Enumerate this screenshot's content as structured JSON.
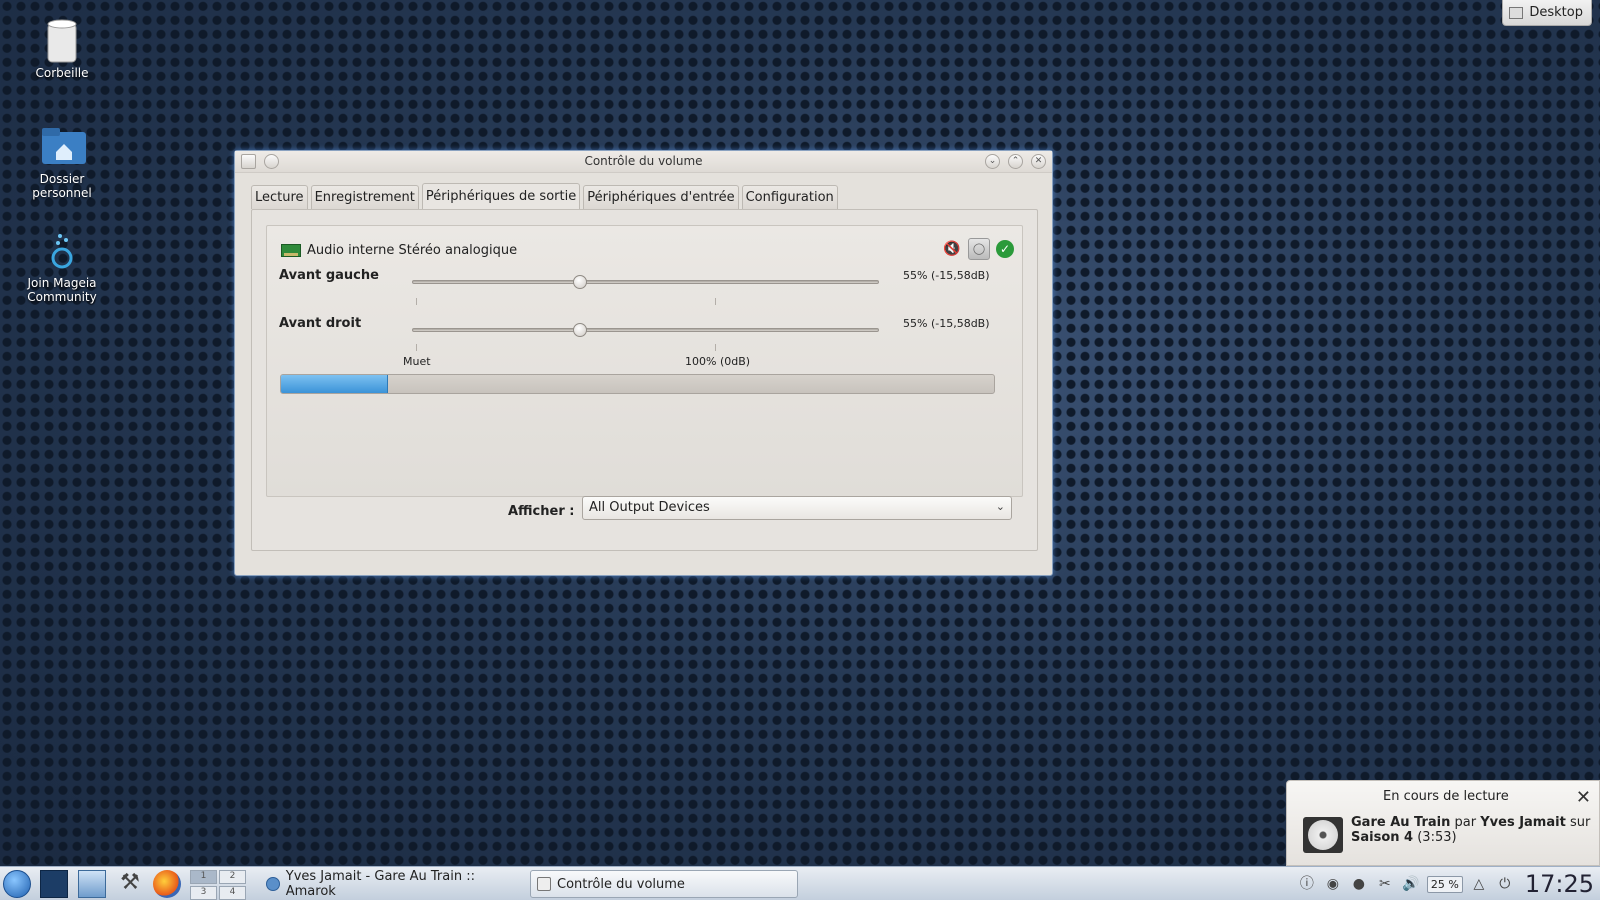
{
  "desktop": {
    "icons": [
      {
        "label": "Corbeille"
      },
      {
        "label": "Dossier\npersonnel"
      },
      {
        "label": "Join Mageia\nCommunity"
      }
    ],
    "desktop_button": "Desktop"
  },
  "window": {
    "title": "Contrôle du volume",
    "tabs": [
      {
        "label": "Lecture"
      },
      {
        "label": "Enregistrement"
      },
      {
        "label": "Périphériques de sortie",
        "active": true
      },
      {
        "label": "Périphériques d'entrée"
      },
      {
        "label": "Configuration"
      }
    ],
    "device": {
      "name": "Audio interne Stéréo analogique",
      "channels": [
        {
          "label": "Avant gauche",
          "level": 0.55,
          "value": "55% (-15,58dB)"
        },
        {
          "label": "Avant droit",
          "level": 0.55,
          "value": "55% (-15,58dB)"
        }
      ],
      "scale_mute": "Muet",
      "scale_full": "100% (0dB)",
      "peak_level": 0.15
    },
    "show_label": "Afficher :",
    "show_value": "All Output Devices"
  },
  "taskbar": {
    "pager": [
      "1",
      "2",
      "3",
      "4"
    ],
    "tasks": [
      {
        "label": "Yves Jamait - Gare Au Train :: Amarok"
      },
      {
        "label": "Contrôle du volume",
        "active": true
      }
    ],
    "battery": "25 %",
    "clock": "17:25"
  },
  "notification": {
    "title": "En cours de lecture",
    "track": "Gare Au Train",
    "by": "par",
    "artist": "Yves Jamait",
    "on": "sur",
    "album": "Saison 4",
    "duration": "(3:53)"
  },
  "colors": {
    "accent": "#3b93d8",
    "desktop_bg": "#243650"
  }
}
